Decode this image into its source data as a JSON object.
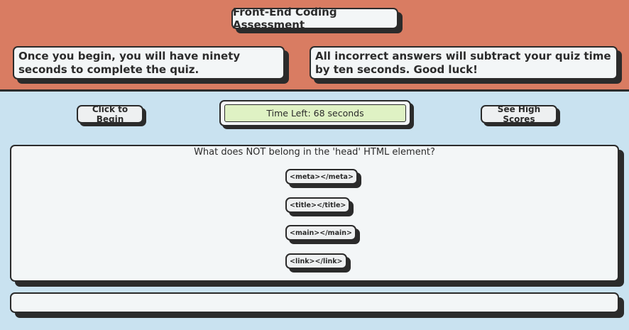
{
  "header": {
    "title": "Front-End Coding Assessment",
    "info_left": "Once you begin, you will have ninety seconds to complete the quiz.",
    "info_right": "All incorrect answers will subtract your quiz time by ten seconds. Good luck!"
  },
  "controls": {
    "begin_label": "Click to Begin",
    "timer_text": "Time Left: 68 seconds",
    "scores_label": "See High Scores"
  },
  "quiz": {
    "question": "What does NOT belong in the 'head' HTML element?",
    "answers": [
      "<meta></meta>",
      "<title></title>",
      "<main></main>",
      "<link></link>"
    ]
  },
  "feedback": {
    "text": ""
  },
  "colors": {
    "header_bg": "#d97c62",
    "page_bg": "#c9e2f0",
    "card_bg": "#f3f6f7",
    "timer_bg": "#dff2c4",
    "border": "#2b2b2b"
  }
}
